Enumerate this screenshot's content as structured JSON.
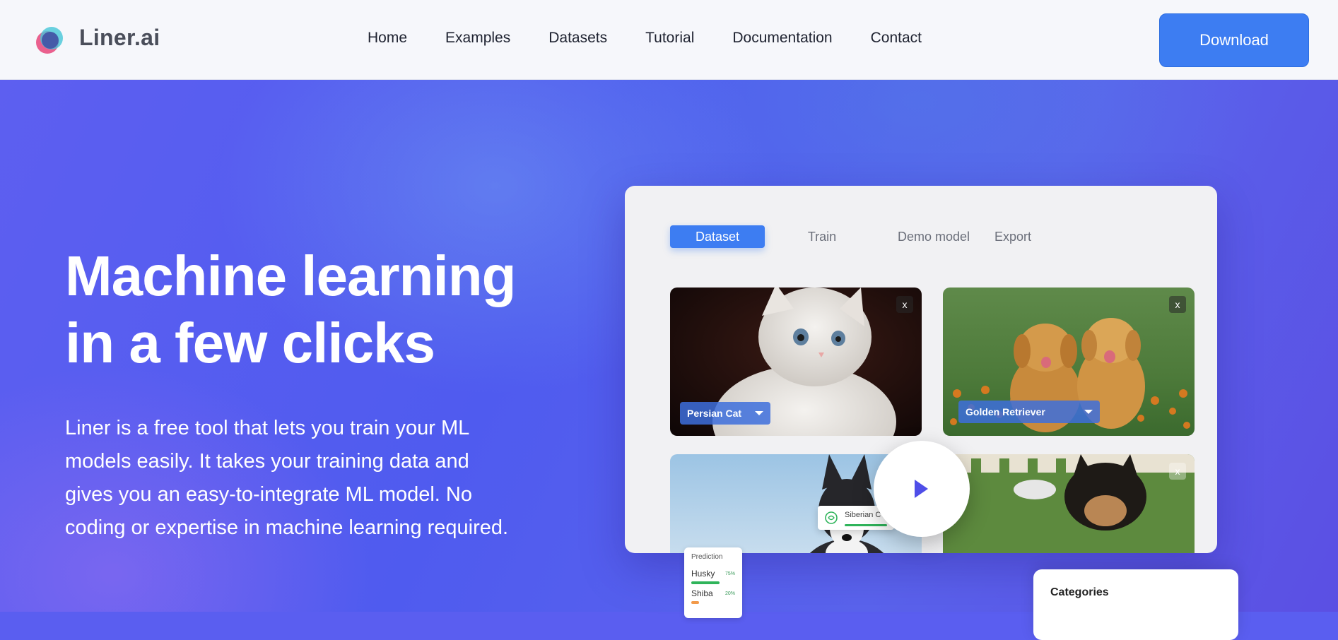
{
  "brand": {
    "name": "Liner.ai",
    "logo_icon": "liner-logo-icon"
  },
  "nav": {
    "links": [
      "Home",
      "Examples",
      "Datasets",
      "Tutorial",
      "Documentation",
      "Contact"
    ],
    "download_label": "Download"
  },
  "hero": {
    "headline_line1": "Machine learning",
    "headline_line2": "in a few clicks",
    "subtext": "Liner is a free tool that lets you train your ML models easily. It takes your training data and gives you an easy-to-integrate ML model. No coding or expertise in machine learning required."
  },
  "app_preview": {
    "tabs": [
      "Dataset",
      "Train",
      "Demo model",
      "Export"
    ],
    "active_tab": "Dataset",
    "tiles": [
      {
        "label": "Persian Cat",
        "close": "x",
        "image": "kitten-photo"
      },
      {
        "label": "Golden Retriever",
        "close": "x",
        "image": "puppies-photo"
      },
      {
        "label": "",
        "close": "x",
        "image": "husky-photo"
      },
      {
        "label": "",
        "close": "x",
        "image": "puppy-photo"
      }
    ],
    "suggestion": {
      "text": "Siberian C",
      "icon": "brain-icon"
    },
    "prediction": {
      "title": "Prediction",
      "rows": [
        {
          "label": "Husky",
          "pct": "75%",
          "value": 0.75,
          "color": "#2fb45a"
        },
        {
          "label": "Shiba",
          "pct": "20%",
          "value": 0.2,
          "color": "#f29a4a"
        }
      ]
    },
    "categories_title": "Categories",
    "play_icon": "play-icon"
  },
  "colors": {
    "accent": "#3d7df2",
    "hero_bg": "#5a5ef0",
    "play": "#4f4ee8"
  }
}
